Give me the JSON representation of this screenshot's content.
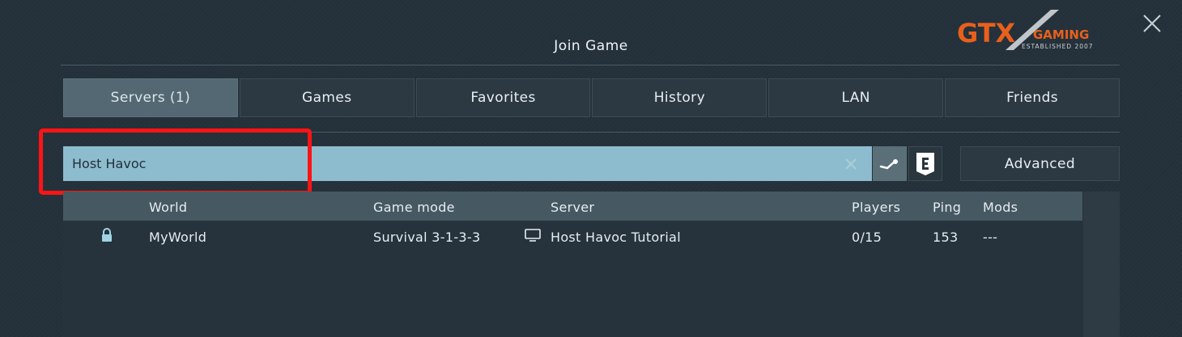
{
  "window": {
    "title": "Join Game"
  },
  "logo": {
    "brand": "GTX",
    "sub": "GAMING",
    "tagline": "ESTABLISHED 2007",
    "accent": "#e8601c"
  },
  "tabs": [
    {
      "label": "Servers (1)",
      "active": true
    },
    {
      "label": "Games"
    },
    {
      "label": "Favorites"
    },
    {
      "label": "History"
    },
    {
      "label": "LAN"
    },
    {
      "label": "Friends"
    }
  ],
  "search": {
    "value": "Host Havoc",
    "placeholder": ""
  },
  "advanced_label": "Advanced",
  "columns": {
    "world": "World",
    "game_mode": "Game mode",
    "server": "Server",
    "players": "Players",
    "ping": "Ping",
    "mods": "Mods"
  },
  "servers": [
    {
      "locked": true,
      "world": "MyWorld",
      "game_mode": "Survival 3-1-3-3",
      "server": "Host Havoc Tutorial",
      "players": "0/15",
      "ping": "153",
      "mods": "---"
    }
  ],
  "colors": {
    "search_bg": "#8dbccf",
    "highlight": "#ff1414",
    "lock": "#9fd3e4"
  }
}
